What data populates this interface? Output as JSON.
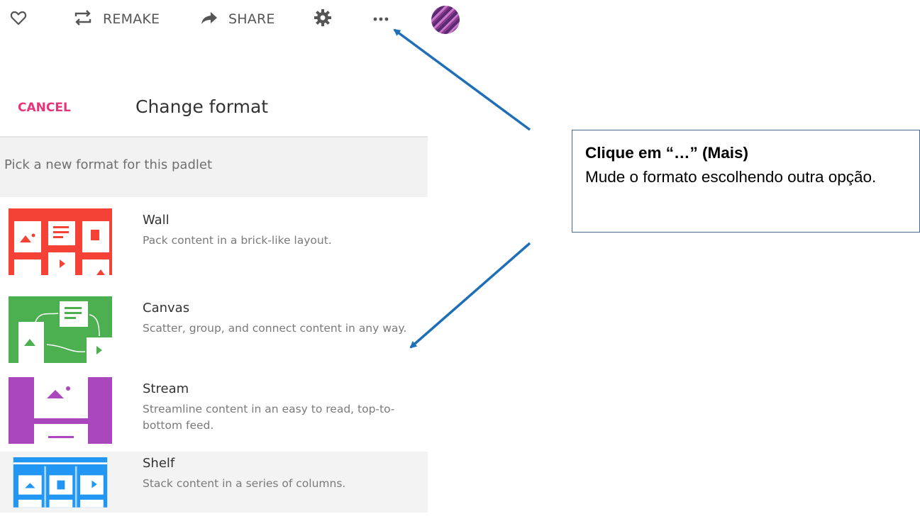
{
  "toolbar": {
    "remake_label": "REMAKE",
    "share_label": "SHARE",
    "icons": [
      "heart-icon",
      "remake-icon",
      "share-icon",
      "gear-icon",
      "more-icon"
    ]
  },
  "panel": {
    "cancel_label": "CANCEL",
    "title": "Change format",
    "subtitle": "Pick a new format for this padlet",
    "formats": [
      {
        "title": "Wall",
        "description": "Pack content in a brick-like layout.",
        "color": "#f44336"
      },
      {
        "title": "Canvas",
        "description": "Scatter, group, and connect content in any way.",
        "color": "#4caf50"
      },
      {
        "title": "Stream",
        "description": "Streamline content in an easy to read, top-to-bottom feed.",
        "color": "#ab47bc"
      },
      {
        "title": "Shelf",
        "description": "Stack content in a series of columns.",
        "color": "#2196f3"
      }
    ]
  },
  "callout": {
    "title": "Clique em “…” (Mais)",
    "body": "Mude o formato escolhendo outra opção."
  },
  "colors": {
    "accent": "#e8357a",
    "arrow": "#1f6fb8"
  }
}
